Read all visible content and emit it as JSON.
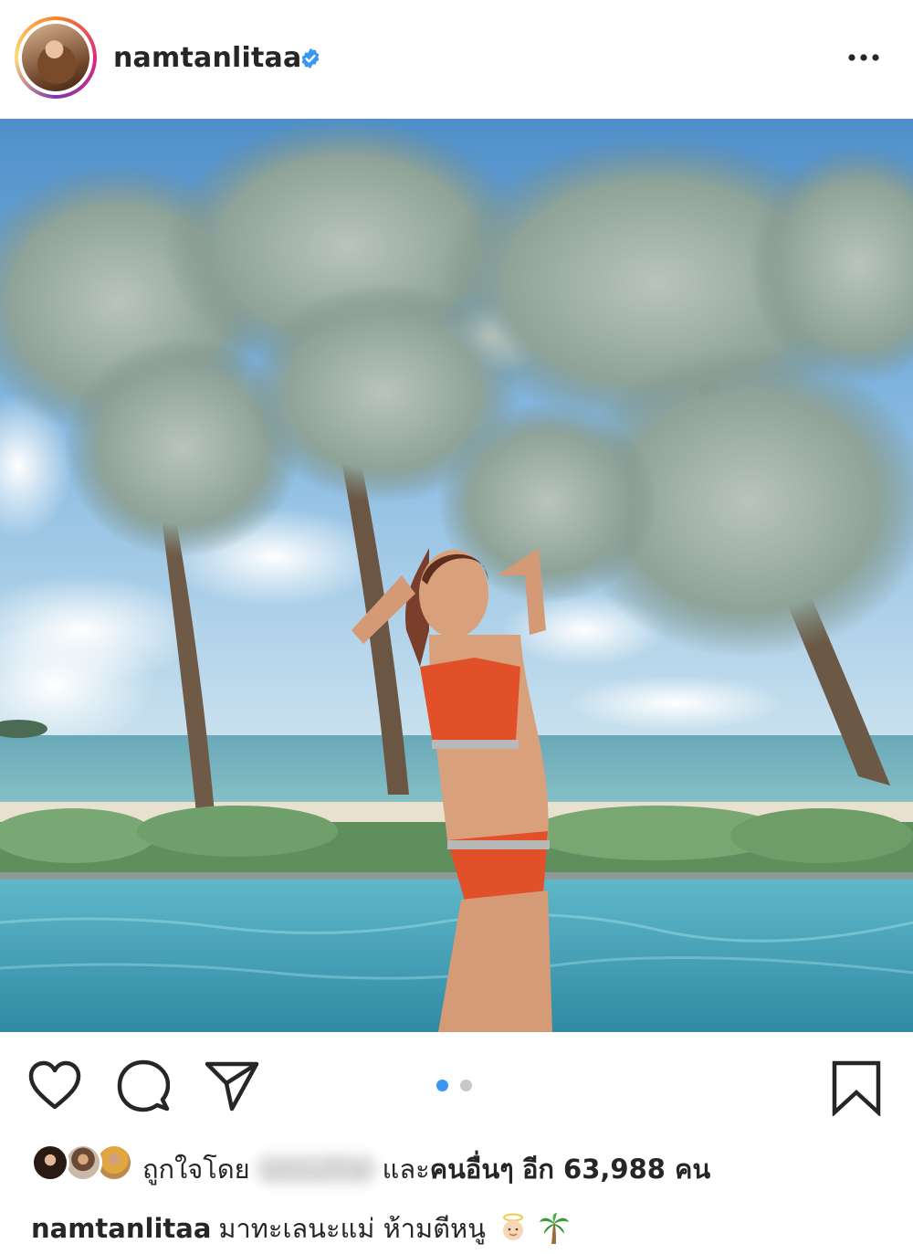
{
  "header": {
    "username": "namtanlitaa",
    "verified": true,
    "more_icon": "more-horizontal-icon"
  },
  "post": {
    "image_description_icon": "post-photo",
    "carousel": {
      "count": 2,
      "active_index": 0,
      "active_color": "#3897f0",
      "inactive_color": "#c7c7c7"
    }
  },
  "actions": {
    "like_icon": "heart-icon",
    "comment_icon": "comment-icon",
    "share_icon": "send-icon",
    "save_icon": "bookmark-icon"
  },
  "likes": {
    "prefix": "ถูกใจโดย",
    "blurred_user": "seoulliw",
    "middle": "และ",
    "others_label": "คนอื่นๆ",
    "count_text": "อีก 63,988 คน"
  },
  "caption": {
    "username": "namtanlitaa",
    "text": "มาทะเลนะแม่ ห้ามตีหนู"
  },
  "colors": {
    "text": "#262626",
    "verified_blue": "#3897f0"
  }
}
